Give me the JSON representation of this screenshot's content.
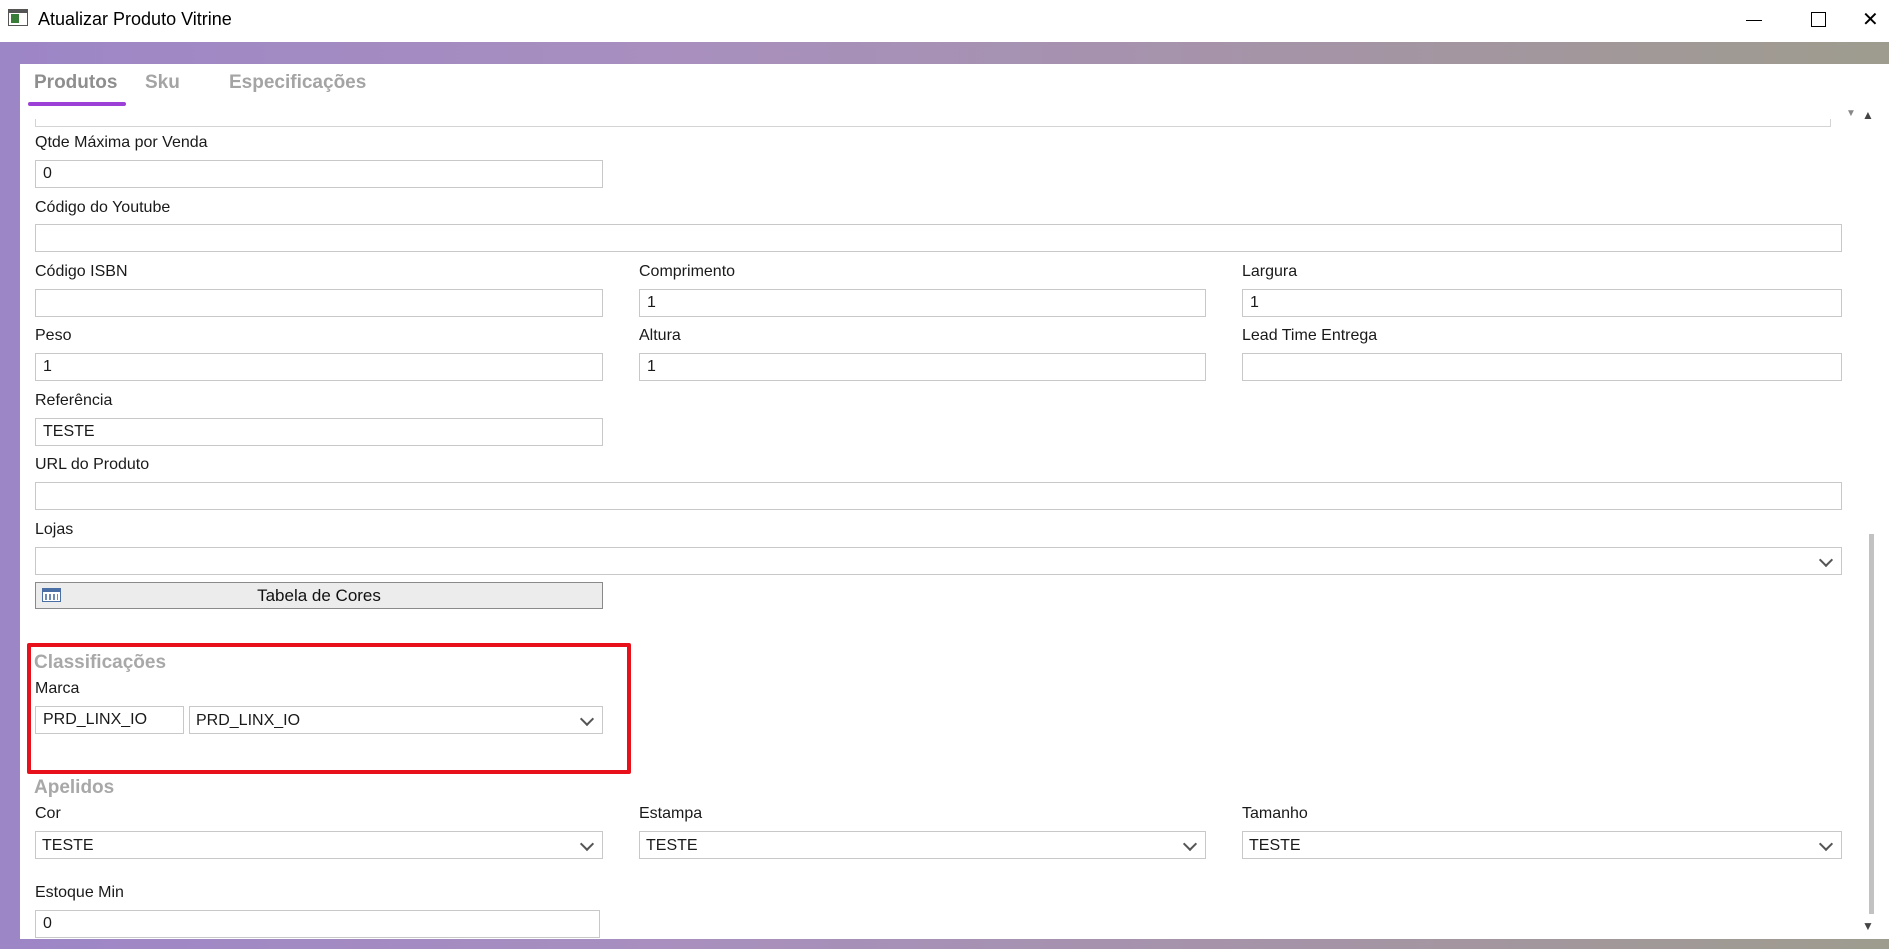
{
  "window": {
    "title": "Atualizar Produto Vitrine",
    "close_glyph": "✕"
  },
  "tabs": [
    {
      "label": "Produtos",
      "active": true
    },
    {
      "label": "Sku",
      "active": false
    },
    {
      "label": "Especificações",
      "active": false
    }
  ],
  "fields": {
    "qtde_maxima": {
      "label": "Qtde Máxima por Venda",
      "value": "0"
    },
    "codigo_youtube": {
      "label": "Código do Youtube",
      "value": ""
    },
    "codigo_isbn": {
      "label": "Código ISBN",
      "value": ""
    },
    "comprimento": {
      "label": "Comprimento",
      "value": "1"
    },
    "largura": {
      "label": "Largura",
      "value": "1"
    },
    "peso": {
      "label": "Peso",
      "value": "1"
    },
    "altura": {
      "label": "Altura",
      "value": "1"
    },
    "lead_time": {
      "label": "Lead Time Entrega",
      "value": ""
    },
    "referencia": {
      "label": "Referência",
      "value": "TESTE"
    },
    "url_produto": {
      "label": "URL do Produto",
      "value": ""
    },
    "lojas": {
      "label": "Lojas",
      "value": ""
    }
  },
  "buttons": {
    "tabela_cores": "Tabela de Cores"
  },
  "classificacoes": {
    "title": "Classificações",
    "marca_label": "Marca",
    "marca_code": "PRD_LINX_IO",
    "marca_select": "PRD_LINX_IO"
  },
  "apelidos": {
    "title": "Apelidos",
    "cor": {
      "label": "Cor",
      "value": "TESTE"
    },
    "estampa": {
      "label": "Estampa",
      "value": "TESTE"
    },
    "tamanho": {
      "label": "Tamanho",
      "value": "TESTE"
    }
  },
  "estoque_min": {
    "label": "Estoque Min",
    "value": "0"
  },
  "colors": {
    "tab_underline": "#9b3fd6",
    "highlight_border": "#e8101a"
  },
  "icons": [
    "app-icon",
    "minimize-icon",
    "maximize-icon",
    "close-icon",
    "calendar-grid-icon",
    "chevron-down-icon"
  ]
}
